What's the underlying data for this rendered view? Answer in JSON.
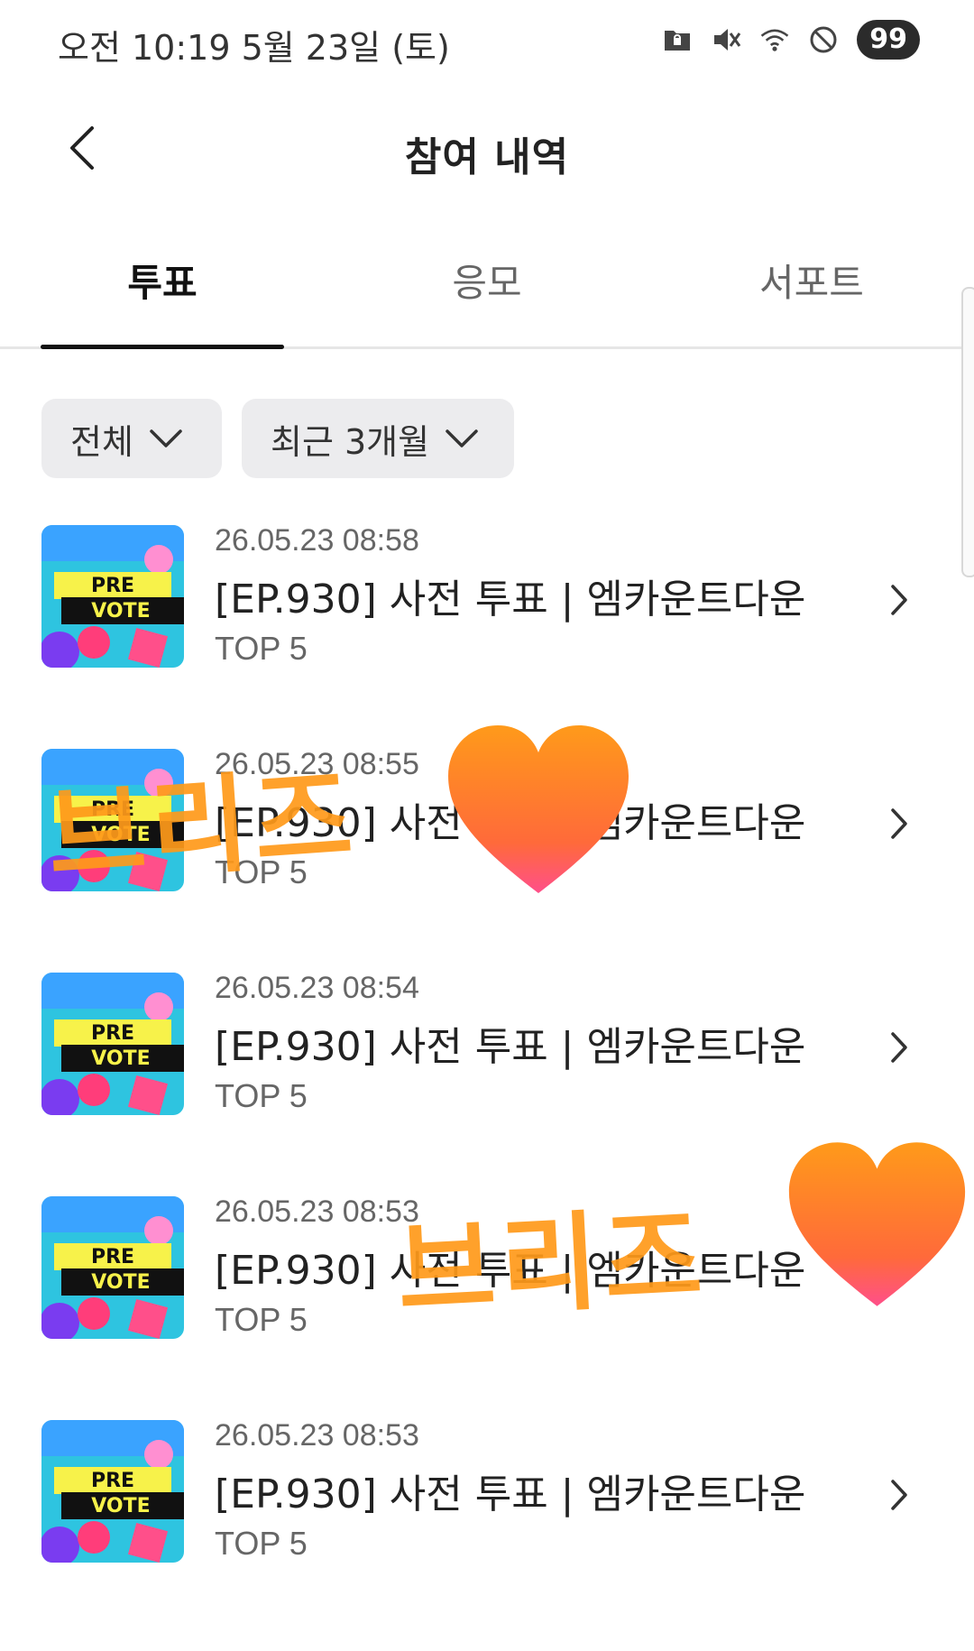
{
  "status_bar": {
    "time_text": "오전 10:19  5월 23일 (토)",
    "battery": "99",
    "icons": [
      "folder-lock-icon",
      "mute-icon",
      "wifi-icon",
      "do-not-disturb-icon"
    ]
  },
  "header": {
    "title": "참여 내역",
    "back_icon": "chevron-left-icon"
  },
  "tabs": [
    {
      "label": "투표",
      "active": true
    },
    {
      "label": "응모",
      "active": false
    },
    {
      "label": "서포트",
      "active": false
    }
  ],
  "filters": [
    {
      "label": "전체",
      "icon": "chevron-down-icon"
    },
    {
      "label": "최근 3개월",
      "icon": "chevron-down-icon"
    }
  ],
  "items": [
    {
      "date": "26.05.23 08:58",
      "title": "[EP.930] 사전 투표 | 엠카운트다운",
      "subtitle": "TOP 5",
      "thumb_text": [
        "PRE",
        "VOTE"
      ]
    },
    {
      "date": "26.05.23 08:55",
      "title": "[EP.930] 사전 투표 | 엠카운트다운",
      "subtitle": "TOP 5",
      "thumb_text": [
        "PRE",
        "VOTE"
      ]
    },
    {
      "date": "26.05.23 08:54",
      "title": "[EP.930] 사전 투표 | 엠카운트다운",
      "subtitle": "TOP 5",
      "thumb_text": [
        "PRE",
        "VOTE"
      ]
    },
    {
      "date": "26.05.23 08:53",
      "title": "[EP.930] 사전 투표 | 엠카운트다운",
      "subtitle": "TOP 5",
      "thumb_text": [
        "PRE",
        "VOTE"
      ]
    },
    {
      "date": "26.05.23 08:53",
      "title": "[EP.930] 사전 투표 | 엠카운트다운",
      "subtitle": "TOP 5",
      "thumb_text": [
        "PRE",
        "VOTE"
      ]
    }
  ],
  "overlays": {
    "text": "브리즈",
    "heart_icon": "orange-heart-icon",
    "color": "#ff9a1a"
  },
  "colors": {
    "active_tab": "#111111",
    "inactive_tab": "#666666",
    "filter_bg": "#ececee",
    "thumb_bg": "#2ec4e0",
    "thumb_banner": "#111111",
    "thumb_yellow": "#f7f24a"
  }
}
